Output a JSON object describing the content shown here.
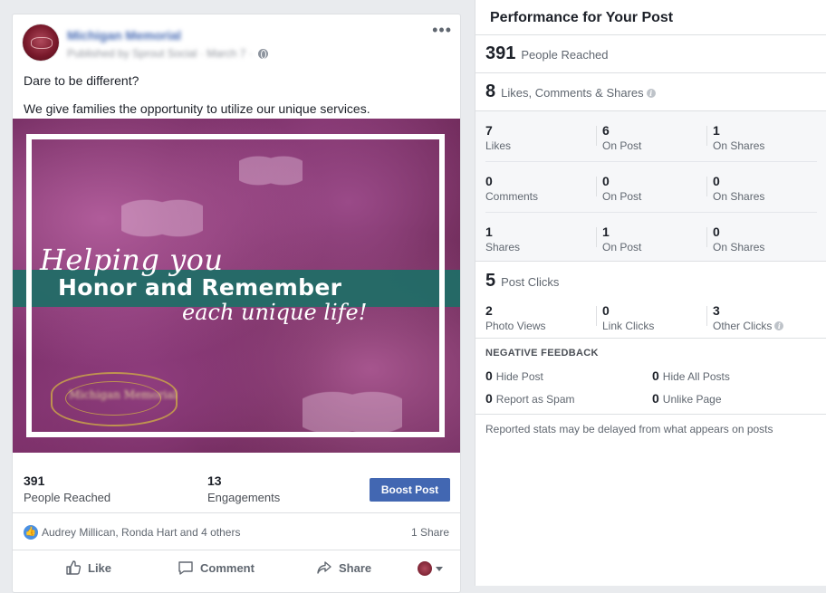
{
  "post": {
    "page_name": "Michigan Memorial",
    "published_by": "Published by Sprout Social · March 7 ·",
    "text_lines": [
      "Dare to be different?",
      "We give families the opportunity to utilize our unique services."
    ],
    "image": {
      "script_top": "Helping you",
      "main": "Honor and Remember",
      "script_bottom": "each unique life!",
      "logo_text": "Michigan Memorial"
    },
    "stats": {
      "reached_num": "391",
      "reached_label": "People Reached",
      "engagements_num": "13",
      "engagements_label": "Engagements",
      "boost_label": "Boost Post"
    },
    "reactions": {
      "names": "Audrey Millican, Ronda Hart and 4 others",
      "shares": "1 Share"
    },
    "actions": {
      "like": "Like",
      "comment": "Comment",
      "share": "Share"
    }
  },
  "performance": {
    "title": "Performance for Your Post",
    "reached": {
      "num": "391",
      "label": "People Reached"
    },
    "engagement": {
      "num": "8",
      "label": "Likes, Comments & Shares"
    },
    "rows": [
      [
        {
          "n": "7",
          "l": "Likes"
        },
        {
          "n": "6",
          "l": "On Post"
        },
        {
          "n": "1",
          "l": "On Shares"
        }
      ],
      [
        {
          "n": "0",
          "l": "Comments"
        },
        {
          "n": "0",
          "l": "On Post"
        },
        {
          "n": "0",
          "l": "On Shares"
        }
      ],
      [
        {
          "n": "1",
          "l": "Shares"
        },
        {
          "n": "1",
          "l": "On Post"
        },
        {
          "n": "0",
          "l": "On Shares"
        }
      ]
    ],
    "clicks": {
      "num": "5",
      "label": "Post Clicks"
    },
    "click_row": [
      {
        "n": "2",
        "l": "Photo Views"
      },
      {
        "n": "0",
        "l": "Link Clicks"
      },
      {
        "n": "3",
        "l": "Other Clicks"
      }
    ],
    "negative": {
      "title": "NEGATIVE FEEDBACK",
      "items": [
        {
          "n": "0",
          "l": "Hide Post"
        },
        {
          "n": "0",
          "l": "Hide All Posts"
        },
        {
          "n": "0",
          "l": "Report as Spam"
        },
        {
          "n": "0",
          "l": "Unlike Page"
        }
      ]
    },
    "footnote": "Reported stats may be delayed from what appears on posts"
  },
  "colors": {
    "brand_blue": "#4267b2",
    "teal_band": "#1d6e66",
    "image_purple": "#7b2f68"
  }
}
